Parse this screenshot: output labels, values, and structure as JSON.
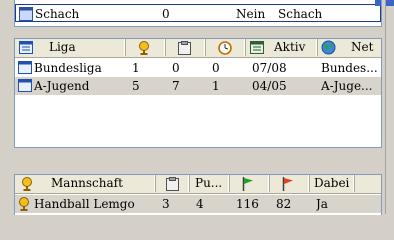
{
  "top_table": {
    "row": {
      "name": "Schach",
      "val": "0",
      "flag": "Nein",
      "type": "Schach"
    }
  },
  "liga_table": {
    "headers": {
      "liga": "Liga",
      "aktiv": "Aktiv",
      "net": "Net"
    },
    "rows": [
      {
        "name": "Bundesliga",
        "c1": "1",
        "c2": "0",
        "c3": "0",
        "aktiv": "07/08",
        "net": "Bundes..."
      },
      {
        "name": "A-Jugend",
        "c1": "5",
        "c2": "7",
        "c3": "1",
        "aktiv": "04/05",
        "net": "A-Juge..."
      }
    ]
  },
  "team_table": {
    "headers": {
      "mannschaft": "Mannschaft",
      "punkte": "Pu...",
      "dabei": "Dabei"
    },
    "rows": [
      {
        "name": "Handball Lemgo",
        "c1": "3",
        "c2": "4",
        "c3": "116",
        "c4": "82",
        "dabei": "Ja"
      }
    ]
  },
  "icons": {
    "trophy": "trophy-icon",
    "clipboard": "clipboard-icon",
    "clock": "clock-icon",
    "calendar": "calendar-icon",
    "globe": "globe-icon",
    "green_flag": "green-flag-icon",
    "red_flag": "red-flag-icon"
  },
  "colors": {
    "selection_border": "#1c3c8c",
    "header_bg": "#ece9d8",
    "accent_blue": "#3a64c8"
  }
}
